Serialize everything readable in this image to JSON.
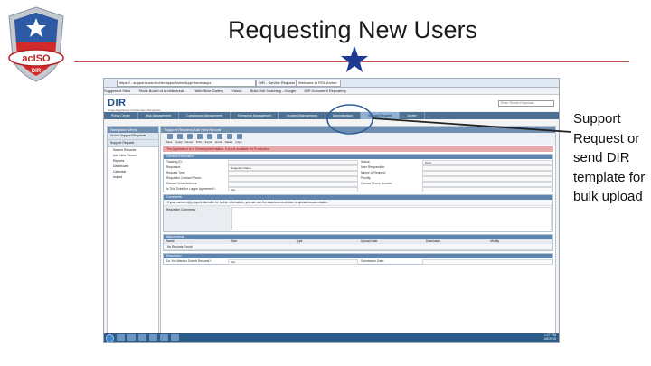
{
  "slide": {
    "title": "Requesting New Users",
    "callout": "Support Request or send DIR template for bulk upload",
    "logo_text": "acISO",
    "logo_sub": "DIR"
  },
  "colors": {
    "rule": "#c0504d",
    "star": "#1f3a93",
    "nav": "#4d6f92",
    "warning": "#e7a9aa",
    "annotation": "#2f5f9a"
  },
  "browser": {
    "address": "https://...support.com/Archer/apps/ArcherApp/Home.aspx",
    "tabs": [
      "DIR - Service Request",
      "Welcome to RSA Archer"
    ],
    "favorites": [
      "Suggested Sites",
      "Texas Board of Architectural...",
      "Web Slice Gallery",
      "Yahoo",
      "Build Job Seaching - Google",
      "DIR Document Repository"
    ]
  },
  "app": {
    "logo": "DIR",
    "logo_sub": "Texas Department of Information Resources",
    "search_placeholder": "Enter Search Keywords",
    "nav": [
      "Policy Center",
      "Risk Management",
      "Compliance Management",
      "Enterprise Management",
      "Incident Management",
      "Administration",
      "Support Request",
      "Archer"
    ],
    "active_nav_index": 6
  },
  "sidebar": {
    "header": "Navigation Menu",
    "sub1": "Archer Support Requests",
    "sub2": "Support Request",
    "items": [
      "Search Records",
      "Add New Record",
      "Reports",
      "Dashboard",
      "Calendar",
      "Import"
    ]
  },
  "main": {
    "header": "Support Request: Add New Record",
    "toolbar": [
      "Save",
      "Apply",
      "Cancel",
      "Print",
      "Export",
      "Email",
      "Relate",
      "Copy"
    ],
    "warning": "The Application is in Development status. It is not available for Production.",
    "general_header": "General Information",
    "general_rows": [
      [
        "Tracking ID:",
        "",
        "Status:",
        "Open"
      ],
      [
        "Requestor:",
        "Requestor Name",
        "User Responsible:",
        ""
      ],
      [
        "Request Type:",
        "",
        "Nature of Request:",
        ""
      ],
      [
        "Requestor Contact Phone:",
        "",
        "Priority:",
        ""
      ],
      [
        "Contact Email Address:",
        "",
        "Contact Phone Number:",
        ""
      ],
      [
        "Is This Ticket for Longer Agreement?:",
        "Yes",
        "",
        ""
      ]
    ],
    "comments_header": "Comments",
    "comments_info": "If your comment(s) require attention for further information, you can use the attachments section to upload documentation.",
    "comments_label": "Requester Comments:",
    "attachments_header": "Attachments",
    "attachments_cols": [
      "Name",
      "Size",
      "Type",
      "Upload Date",
      "Downloads",
      "Modify"
    ],
    "attachments_empty": "No Records Found",
    "resolution_header": "Resolution",
    "resolution_rows": [
      [
        "Do You Want to Submit Request?:",
        "Yes",
        "Submission Date:",
        ""
      ]
    ]
  },
  "taskbar": {
    "time": "1:27 PM",
    "date": "1/8/2015"
  }
}
